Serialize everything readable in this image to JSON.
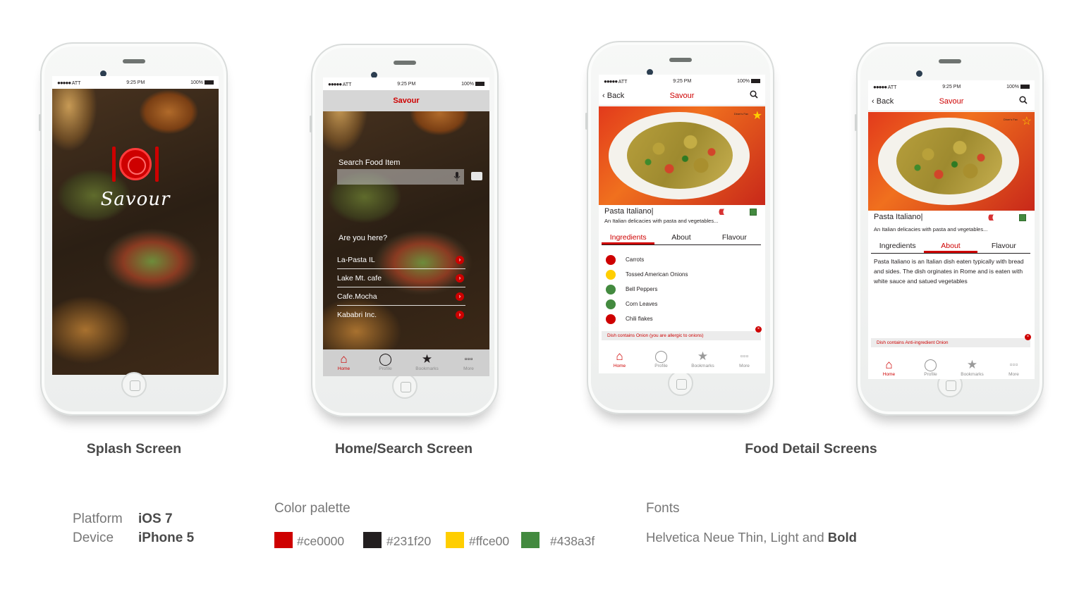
{
  "status": {
    "carrier": "ATT",
    "time": "9:25 PM",
    "battery": "100%"
  },
  "splash": {
    "brand": "Savour"
  },
  "home": {
    "title": "Savour",
    "search_label": "Search Food Item",
    "nearby_label": "Are you here?",
    "locations": [
      "La-Pasta IL",
      "Lake Mt. cafe",
      "Cafe.Mocha",
      "Kababri Inc."
    ]
  },
  "tabs": [
    "Home",
    "Profile",
    "Bookmarks",
    "More"
  ],
  "detail": {
    "back": "Back",
    "title": "Savour",
    "favs_tag": "Diner's Fav",
    "dish_name": "Pasta Italiano|",
    "dish_desc": "An Italian delicacies with pasta and vegetables...",
    "spice": "((((((",
    "segments": [
      "Ingredients",
      "About",
      "Flavour"
    ],
    "ingredients": [
      {
        "name": "Carrots",
        "color": "#ce0000"
      },
      {
        "name": "Tossed American Onions",
        "color": "#ffce00"
      },
      {
        "name": "Bell Peppers",
        "color": "#438a3f"
      },
      {
        "name": "Corn Leaves",
        "color": "#438a3f"
      },
      {
        "name": "Chili flakes",
        "color": "#ce0000"
      }
    ],
    "allergy_warning": "Dish contains Onion (you are allergic to onions)",
    "about_text": "Pasta Italiano is an Italian dish eaten typically with bread and sides. The dish orginates in Rome and is eaten with white sauce and satued vegetables",
    "about_warning": "Dish contains Anti-ingredient Onion"
  },
  "captions": {
    "splash": "Splash Screen",
    "home": "Home/Search Screen",
    "detail": "Food Detail Screens"
  },
  "specs": {
    "platform_label": "Platform",
    "platform_value": "iOS 7",
    "device_label": "Device",
    "device_value": "iPhone 5"
  },
  "palette": {
    "heading": "Color palette",
    "colors": [
      "#ce0000",
      "#231f20",
      "#ffce00",
      "#438a3f"
    ],
    "labels": [
      "#ce0000",
      "#231f20",
      "#ffce00",
      "#438a3f"
    ]
  },
  "fonts": {
    "heading": "Fonts",
    "text": "Helvetica Neue Thin, Light and",
    "bold": "Bold"
  },
  "colors": {
    "brand_red": "#ce0000",
    "dark": "#231f20",
    "yellow": "#ffce00",
    "green": "#438a3f"
  }
}
